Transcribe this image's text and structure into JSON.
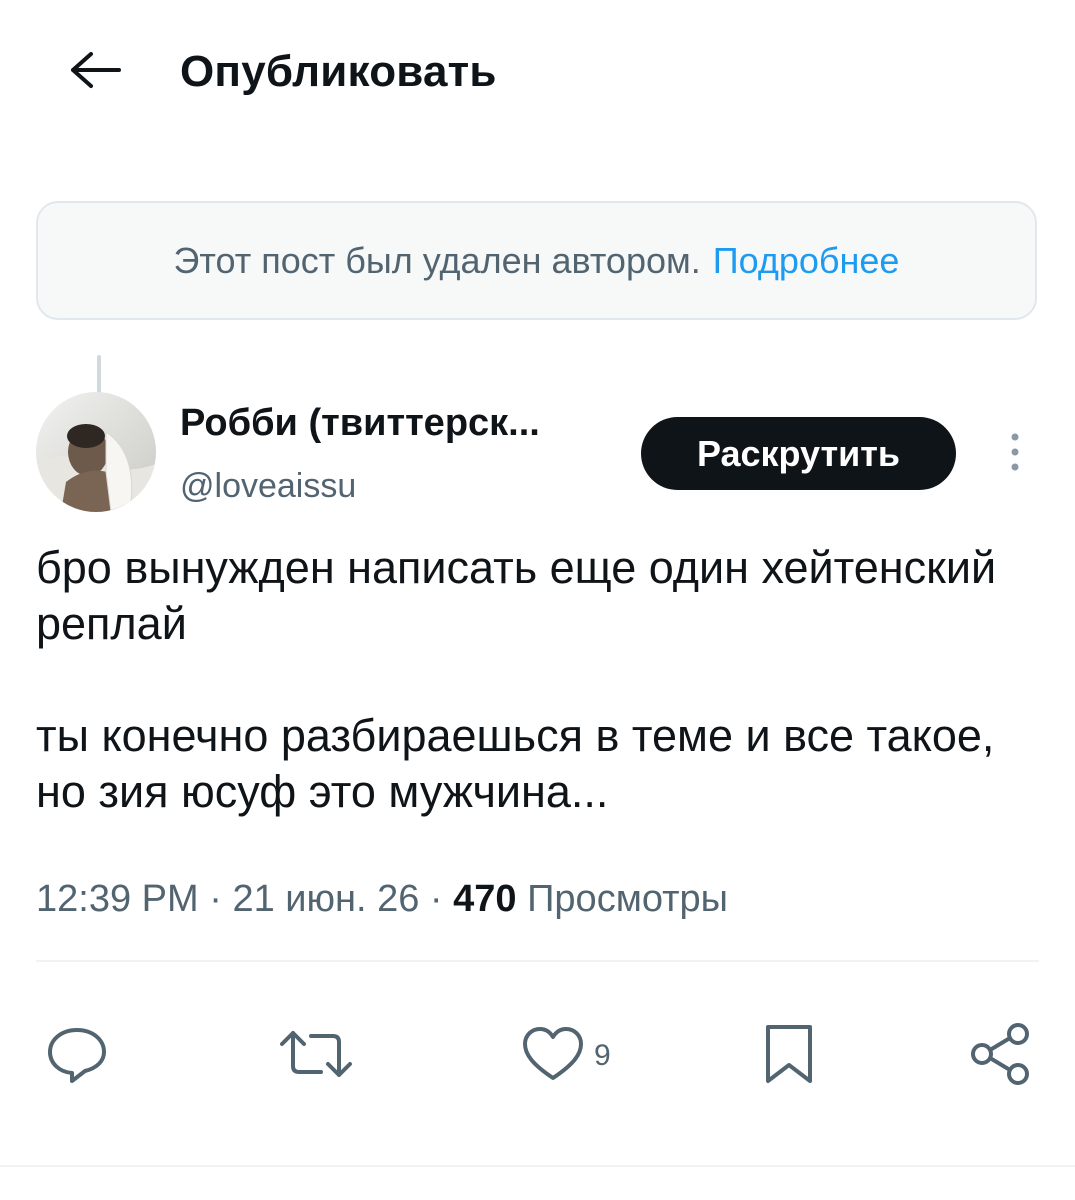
{
  "header": {
    "back_icon": "arrow-left-icon",
    "title": "Опубликовать"
  },
  "deleted_notice": {
    "text": "Этот пост был удален автором.",
    "link": "Подробнее",
    "link_color": "#1d9bf0"
  },
  "post": {
    "author_name": "Робби (твиттерск...",
    "author_handle": "@loveaissu",
    "promote_label": "Раскрутить",
    "more_icon": "vertical-dots-icon",
    "text_para1": "бро вынужден написать еще один хейтенский реплай",
    "text_para2": "ты конечно разбираешься в теме и все такое, но зия юсуф это мужчина...",
    "time": "12:39 PM",
    "separator": "·",
    "date": "21 июн. 26",
    "views_count": "470",
    "views_label": "Просмотры"
  },
  "actions": {
    "reply_icon": "reply-icon",
    "repost_icon": "repost-icon",
    "like_icon": "heart-icon",
    "like_count": "9",
    "bookmark_icon": "bookmark-icon",
    "share_icon": "share-icon"
  },
  "colors": {
    "text_primary": "#0f1419",
    "text_secondary": "#536471",
    "accent": "#1d9bf0",
    "promote_bg": "#0f1419"
  }
}
